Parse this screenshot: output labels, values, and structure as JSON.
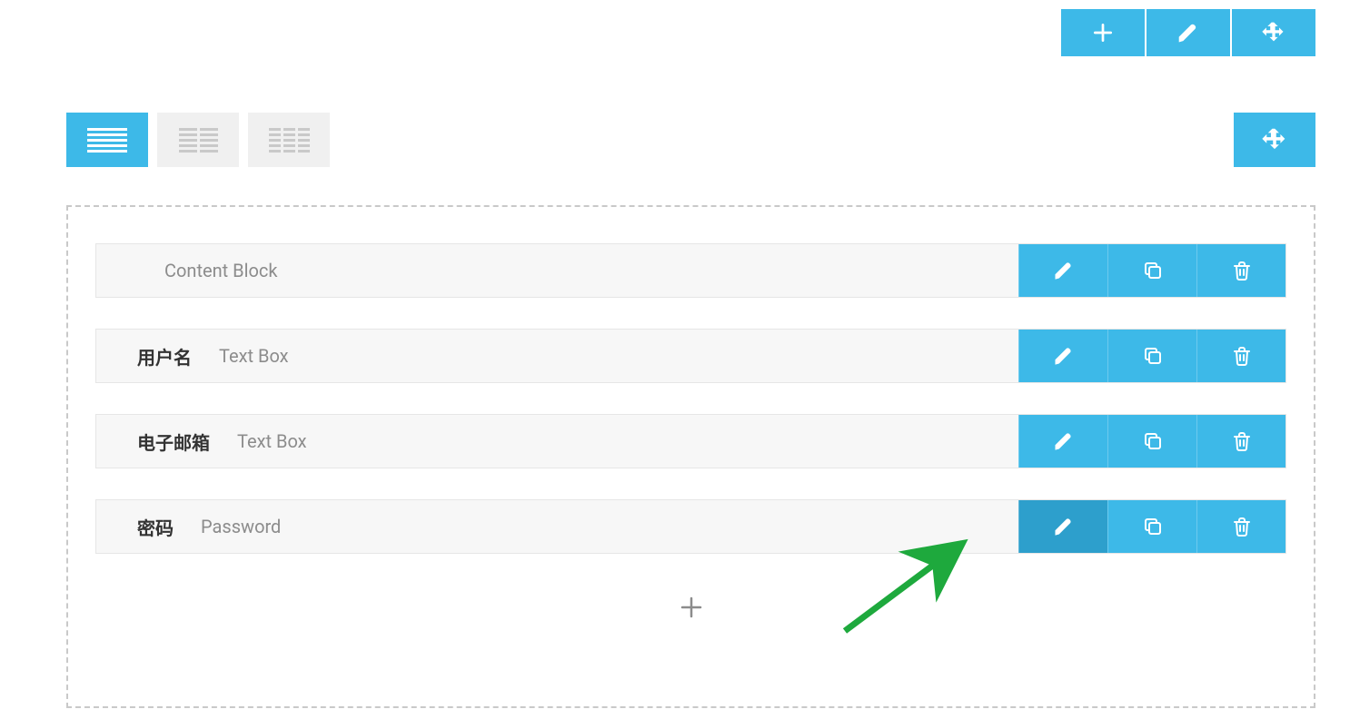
{
  "colors": {
    "accent": "#3db9e8",
    "accent_hover": "#2d9fcc",
    "border_dashed": "#c9c9c9",
    "text_muted": "#8c8c8c",
    "text_label": "#333333",
    "row_bg": "#f7f7f7",
    "annotation_green": "#1ea93d"
  },
  "top_toolbar": {
    "add_icon": "plus-icon",
    "edit_icon": "pencil-icon",
    "move_icon": "move-icon"
  },
  "layout_tabs": {
    "active_index": 0,
    "items": [
      "one-column",
      "two-column",
      "three-column"
    ]
  },
  "fields": [
    {
      "label": "",
      "type": "Content Block",
      "edit_hover": false
    },
    {
      "label": "用户名",
      "type": "Text Box",
      "edit_hover": false
    },
    {
      "label": "电子邮箱",
      "type": "Text Box",
      "edit_hover": false
    },
    {
      "label": "密码",
      "type": "Password",
      "edit_hover": true
    }
  ],
  "row_actions": {
    "edit": "pencil-icon",
    "copy": "copy-icon",
    "delete": "trash-icon"
  },
  "add_field_icon": "plus-icon"
}
